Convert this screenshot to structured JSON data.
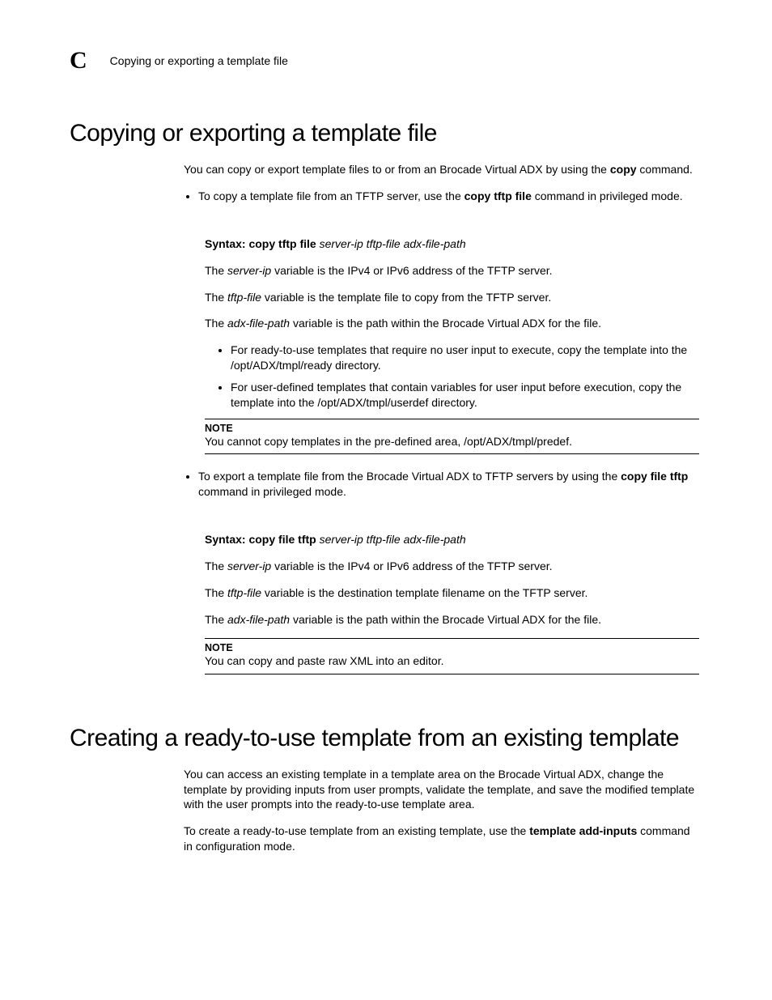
{
  "header": {
    "appendix": "C",
    "breadcrumb": "Copying or exporting a template file"
  },
  "s1": {
    "title": "Copying or exporting a template file",
    "intro_1": "You can copy or export template files to or from an Brocade Virtual ADX by using the ",
    "intro_cmd": "copy",
    "intro_2": " command.",
    "b1_1": "To copy a template file from an TFTP server, use the ",
    "b1_cmd": "copy tftp file",
    "b1_2": " command in privileged mode.",
    "syn1_label": "Syntax:  ",
    "syn1_cmd": "copy tftp file",
    "syn1_args": " server-ip tftp-file adx-file-path",
    "p1_1a": "The ",
    "p1_1b": "server-ip",
    "p1_1c": " variable is the IPv4 or IPv6 address of the TFTP server.",
    "p1_2a": "The ",
    "p1_2b": "tftp-file",
    "p1_2c": " variable is the template file to copy from the TFTP server.",
    "p1_3a": "The ",
    "p1_3b": "adx-file-path",
    "p1_3c": " variable is the path within the Brocade Virtual ADX for the file.",
    "sub1": "For ready-to-use templates that require no user input to execute, copy the template into the /opt/ADX/tmpl/ready directory.",
    "sub2": "For user-defined templates that contain variables for user input before execution, copy the template into the /opt/ADX/tmpl/userdef directory.",
    "note1_label": "NOTE",
    "note1_text": "You cannot copy templates in the pre-defined area, /opt/ADX/tmpl/predef.",
    "b2_1": "To export a template file from the Brocade Virtual ADX to TFTP servers by using the ",
    "b2_cmd": "copy file tftp",
    "b2_2": " command in privileged mode.",
    "syn2_label": "Syntax:  ",
    "syn2_cmd": "copy file tftp",
    "syn2_args": " server-ip tftp-file adx-file-path",
    "p2_1a": "The ",
    "p2_1b": "server-ip",
    "p2_1c": " variable is the IPv4 or IPv6 address of the TFTP server.",
    "p2_2a": "The ",
    "p2_2b": "tftp-file",
    "p2_2c": " variable is the destination template filename on the TFTP server.",
    "p2_3a": "The ",
    "p2_3b": "adx-file-path",
    "p2_3c": " variable is the path within the Brocade Virtual ADX for the file.",
    "note2_label": "NOTE",
    "note2_text": "You can copy and paste raw XML into an editor."
  },
  "s2": {
    "title": "Creating a ready-to-use template from an existing template",
    "p1": "You can access an existing template in a template area on the Brocade Virtual ADX, change the template by providing inputs from user prompts, validate the template, and save the modified template with the user prompts into the ready-to-use template area.",
    "p2_1": "To create a ready-to-use template from an existing template, use the ",
    "p2_cmd": "template add-inputs",
    "p2_2": " command in configuration mode."
  }
}
